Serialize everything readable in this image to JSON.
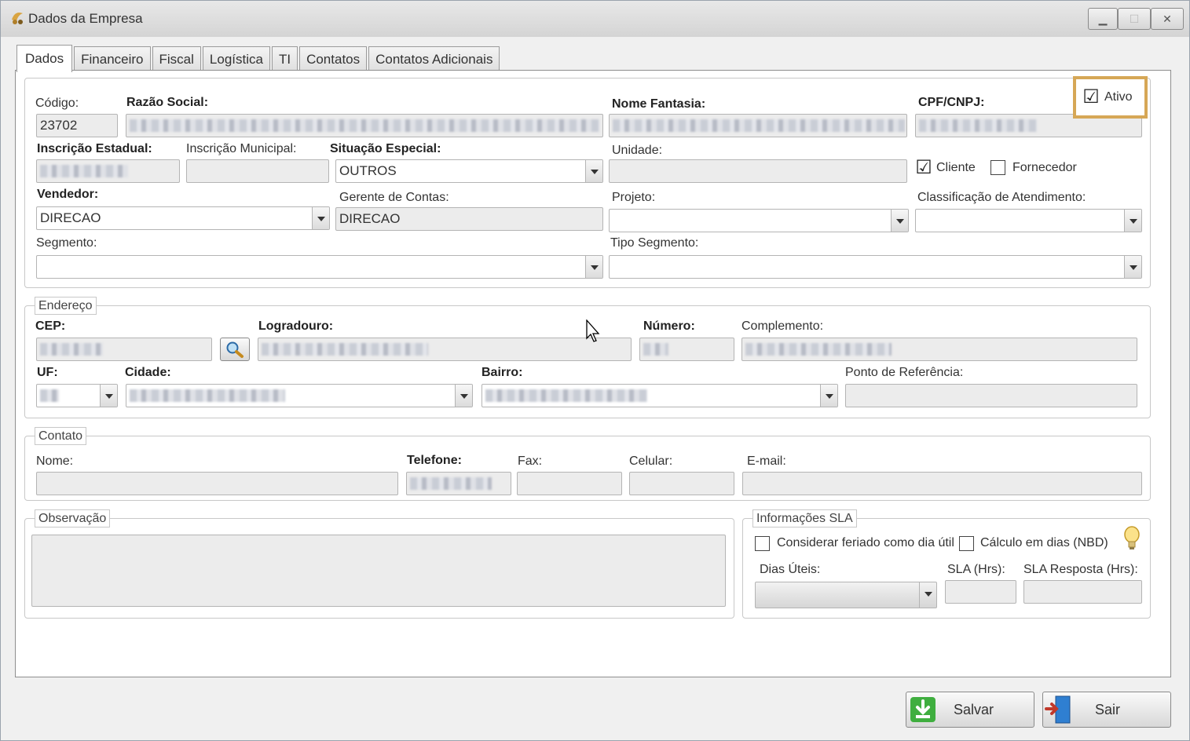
{
  "window": {
    "title": "Dados da Empresa"
  },
  "tabs": [
    "Dados",
    "Financeiro",
    "Fiscal",
    "Logística",
    "TI",
    "Contatos",
    "Contatos Adicionais"
  ],
  "dados": {
    "codigo_label": "Código:",
    "codigo_value": "23702",
    "razao_social_label": "Razão Social:",
    "nome_fantasia_label": "Nome Fantasia:",
    "cpf_cnpj_label": "CPF/CNPJ:",
    "ativo_label": "Ativo",
    "inscricao_estadual_label": "Inscrição Estadual:",
    "inscricao_municipal_label": "Inscrição Municipal:",
    "situacao_especial_label": "Situação Especial:",
    "situacao_especial_value": "OUTROS",
    "unidade_label": "Unidade:",
    "cliente_label": "Cliente",
    "fornecedor_label": "Fornecedor",
    "vendedor_label": "Vendedor:",
    "vendedor_value": "DIRECAO",
    "gerente_label": "Gerente de Contas:",
    "gerente_value": "DIRECAO",
    "projeto_label": "Projeto:",
    "classificacao_label": "Classificação de Atendimento:",
    "segmento_label": "Segmento:",
    "tipo_segmento_label": "Tipo Segmento:"
  },
  "endereco": {
    "title": "Endereço",
    "cep_label": "CEP:",
    "logradouro_label": "Logradouro:",
    "numero_label": "Número:",
    "complemento_label": "Complemento:",
    "uf_label": "UF:",
    "cidade_label": "Cidade:",
    "bairro_label": "Bairro:",
    "ponto_referencia_label": "Ponto de Referência:"
  },
  "contato": {
    "title": "Contato",
    "nome_label": "Nome:",
    "telefone_label": "Telefone:",
    "fax_label": "Fax:",
    "celular_label": "Celular:",
    "email_label": "E-mail:"
  },
  "observacao": {
    "title": "Observação"
  },
  "sla": {
    "title": "Informações SLA",
    "feriado_label": "Considerar feriado como dia útil",
    "nbd_label": "Cálculo em dias (NBD)",
    "dias_uteis_label": "Dias Úteis:",
    "sla_hrs_label": "SLA (Hrs):",
    "sla_resposta_label": "SLA Resposta (Hrs):"
  },
  "buttons": {
    "salvar": "Salvar",
    "sair": "Sair"
  },
  "checks": {
    "ativo": "☑",
    "cliente": "☑"
  },
  "colors": {
    "highlight": "#d6a756",
    "save_green": "#3fae3f",
    "exit_blue": "#2f7fd1"
  }
}
